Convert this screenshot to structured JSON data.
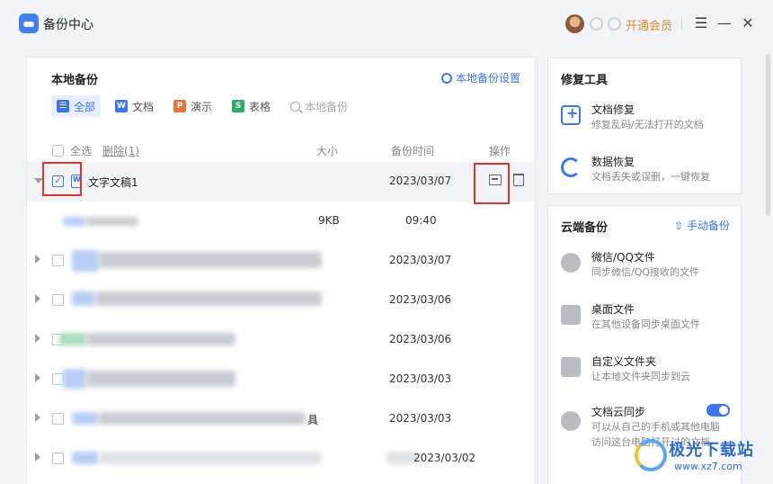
{
  "window": {
    "title": "备份中心",
    "vip_label": "开通会员"
  },
  "icons": {
    "app": "cloud-backup-icon",
    "menu": "hamburger-icon",
    "minimize": "minimize-icon",
    "close": "close-icon"
  },
  "local_backup": {
    "title": "本地备份",
    "settings_label": "本地备份设置",
    "filters": [
      {
        "label": "全部",
        "icon": "☰",
        "active": true
      },
      {
        "label": "文档",
        "icon": "W"
      },
      {
        "label": "演示",
        "icon": "P"
      },
      {
        "label": "表格",
        "icon": "S"
      },
      {
        "label": "本地备份",
        "icon": "search"
      }
    ],
    "columns": {
      "select_all": "全选",
      "delete": "删除(1)",
      "size": "大小",
      "time": "备份时间",
      "ops": "操作"
    },
    "rows": [
      {
        "name": "文字文稿1",
        "time": "2023/03/07",
        "checked": true,
        "expanded": true
      },
      {
        "name": "",
        "size": "9KB",
        "time": "09:40",
        "child": true
      },
      {
        "time": "2023/03/07"
      },
      {
        "time": "2023/03/06"
      },
      {
        "time": "2023/03/06"
      },
      {
        "time": "2023/03/03"
      },
      {
        "time": "2023/03/03",
        "suffix": "具"
      },
      {
        "time": "2023/03/02"
      }
    ]
  },
  "repair_tools": {
    "title": "修复工具",
    "items": [
      {
        "title": "文档修复",
        "desc": "修复乱码/无法打开的文档"
      },
      {
        "title": "数据恢复",
        "desc": "文档丢失或误删，一键恢复"
      }
    ]
  },
  "cloud_backup": {
    "title": "云端备份",
    "manual_label": "手动备份",
    "items": [
      {
        "title": "微信/QQ文件",
        "desc": "同步微信/QQ接收的文件"
      },
      {
        "title": "桌面文件",
        "desc": "在其他设备同步桌面文件"
      },
      {
        "title": "自定义文件夹",
        "desc": "让本地文件夹同步到云"
      },
      {
        "title": "文档云同步",
        "desc": "可以从自己的手机或其他电脑",
        "desc2": "访问这台电脑打开过的文档",
        "toggle_on": true
      }
    ]
  },
  "watermark": {
    "text": "极光下载站",
    "url": "www.xz7.com"
  }
}
